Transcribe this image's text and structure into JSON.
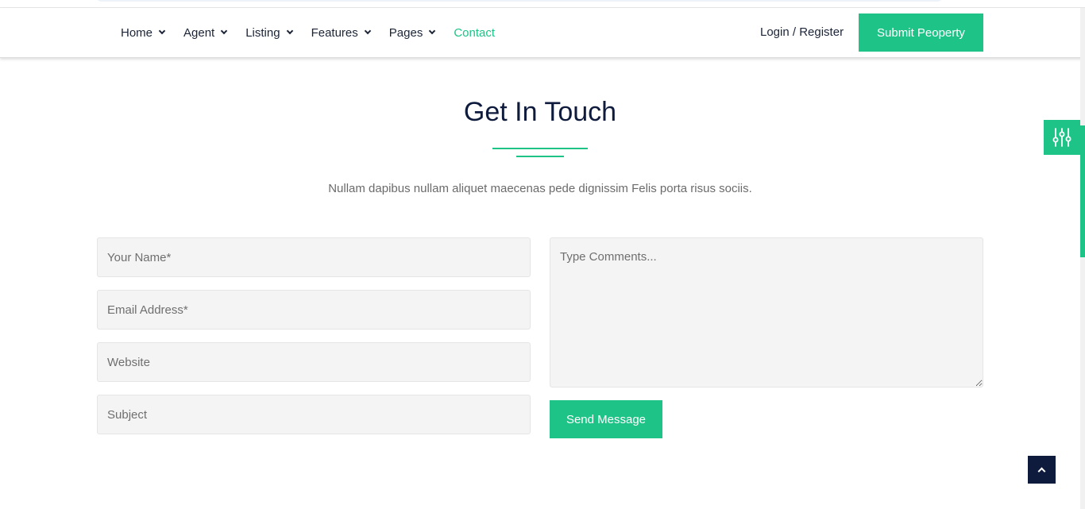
{
  "nav": {
    "items": [
      {
        "label": "Home",
        "has_dropdown": true,
        "active": false
      },
      {
        "label": "Agent",
        "has_dropdown": true,
        "active": false
      },
      {
        "label": "Listing",
        "has_dropdown": true,
        "active": false
      },
      {
        "label": "Features",
        "has_dropdown": true,
        "active": false
      },
      {
        "label": "Pages",
        "has_dropdown": true,
        "active": false
      },
      {
        "label": "Contact",
        "has_dropdown": false,
        "active": true
      }
    ],
    "login_label": "Login / Register",
    "submit_label": "Submit Peoperty"
  },
  "contact": {
    "title": "Get In Touch",
    "subtitle": "Nullam dapibus nullam aliquet maecenas pede dignissim Felis porta risus sociis.",
    "fields": {
      "name_placeholder": "Your Name*",
      "email_placeholder": "Email Address*",
      "website_placeholder": "Website",
      "subject_placeholder": "Subject",
      "comments_placeholder": "Type Comments..."
    },
    "send_label": "Send Message"
  },
  "widgets": {
    "settings_icon": "sliders-icon",
    "scroll_top_icon": "chevron-up-icon"
  },
  "colors": {
    "accent": "#1ec387",
    "dark": "#0f1b3d"
  }
}
